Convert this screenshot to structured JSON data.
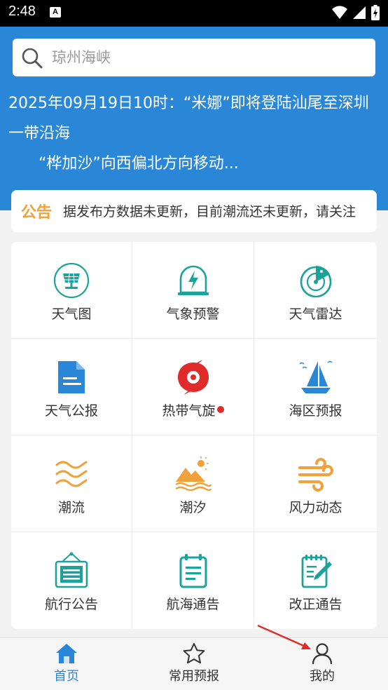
{
  "status_bar": {
    "time": "2:48",
    "notification_glyph": "A"
  },
  "search": {
    "placeholder": "琼州海峡"
  },
  "alert": {
    "line1": "2025年09月19日10时：“米娜”即将登陆汕尾至深圳一带沿海",
    "line2": "“桦加沙”向西偏北方向移动..."
  },
  "notice": {
    "label": "公告",
    "text": "据发布方数据未更新，目前潮流还未更新，请关注"
  },
  "grid": [
    {
      "label": "天气图",
      "icon": "weather-map-icon"
    },
    {
      "label": "气象预警",
      "icon": "weather-warning-icon"
    },
    {
      "label": "天气雷达",
      "icon": "weather-radar-icon"
    },
    {
      "label": "天气公报",
      "icon": "weather-bulletin-icon"
    },
    {
      "label": "热带气旋",
      "icon": "tropical-cyclone-icon",
      "badge": "red-dot"
    },
    {
      "label": "海区预报",
      "icon": "sea-area-forecast-icon"
    },
    {
      "label": "潮流",
      "icon": "tidal-current-icon"
    },
    {
      "label": "潮汐",
      "icon": "tide-icon"
    },
    {
      "label": "风力动态",
      "icon": "wind-dynamics-icon"
    },
    {
      "label": "航行公告",
      "icon": "navigation-notice-icon"
    },
    {
      "label": "航海通告",
      "icon": "nautical-notice-icon"
    },
    {
      "label": "改正通告",
      "icon": "correction-notice-icon"
    }
  ],
  "nav": {
    "home": "首页",
    "common": "常用预报",
    "mine": "我的"
  },
  "colors": {
    "header_blue": "#2a87d8",
    "teal": "#1aa39a",
    "blue": "#2a87d8",
    "orange": "#f0a13a",
    "red": "#e02b2b"
  }
}
